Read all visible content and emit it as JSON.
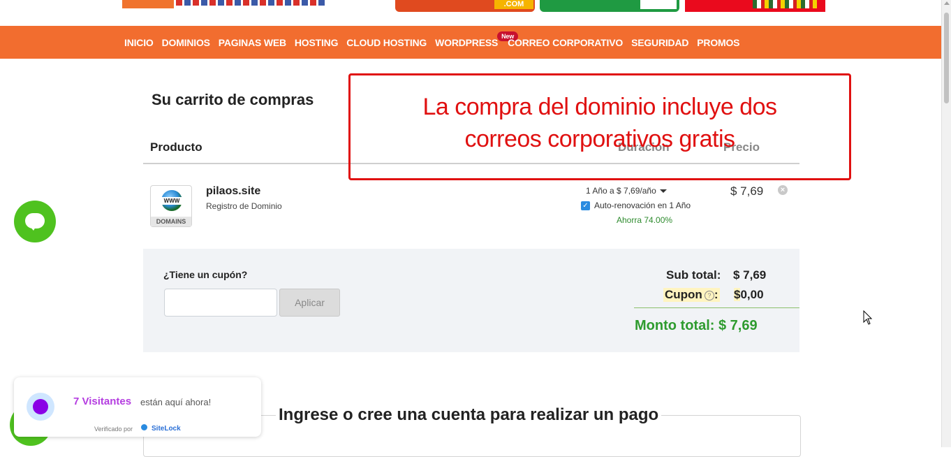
{
  "banner": {
    "promo2_suffix": ".COM"
  },
  "nav": {
    "items": [
      "INICIO",
      "DOMINIOS",
      "PAGINAS WEB",
      "HOSTING",
      "CLOUD HOSTING",
      "WORDPRESS",
      "CORREO CORPORATIVO",
      "SEGURIDAD",
      "PROMOS"
    ],
    "new_badge": "New"
  },
  "cart": {
    "title": "Su carrito de compras",
    "columns": {
      "product": "Producto",
      "duration": "Duración",
      "price": "Precio"
    },
    "item": {
      "icon_text": "WWW",
      "icon_label": "DOMAINS",
      "name": "pilaos.site",
      "type": "Registro de Dominio",
      "duration": "1 Año a $ 7,69/año",
      "auto_renew": "Auto-renovación en 1 Año",
      "savings": "Ahorra 74.00%",
      "price": "$ 7,69"
    }
  },
  "summary": {
    "coupon_label": "¿Tiene un cupón?",
    "coupon_value": "",
    "apply_label": "Aplicar",
    "subtotal_label": "Sub total:",
    "subtotal_value": "$ 7,69",
    "coupon_row_label": "Cupon",
    "coupon_help": "?",
    "coupon_colon": ":",
    "coupon_dollar": "$",
    "coupon_amount": "0,00",
    "total_label": "Monto total:",
    "total_value": "$ 7,69"
  },
  "callout": {
    "line1": "La compra del dominio incluye dos",
    "line2": "correos corporativos gratis"
  },
  "login": {
    "title": "Ingrese o cree una cuenta para realizar un pago"
  },
  "visitors": {
    "count": "7 Visitantes",
    "text": "están aquí ahora!",
    "verified": "Verificado por",
    "brand": "SiteLock"
  },
  "colors": {
    "nav": "#f26d2f",
    "callout": "#e01010",
    "total": "#2e9b2e",
    "chat": "#4fc21f"
  }
}
